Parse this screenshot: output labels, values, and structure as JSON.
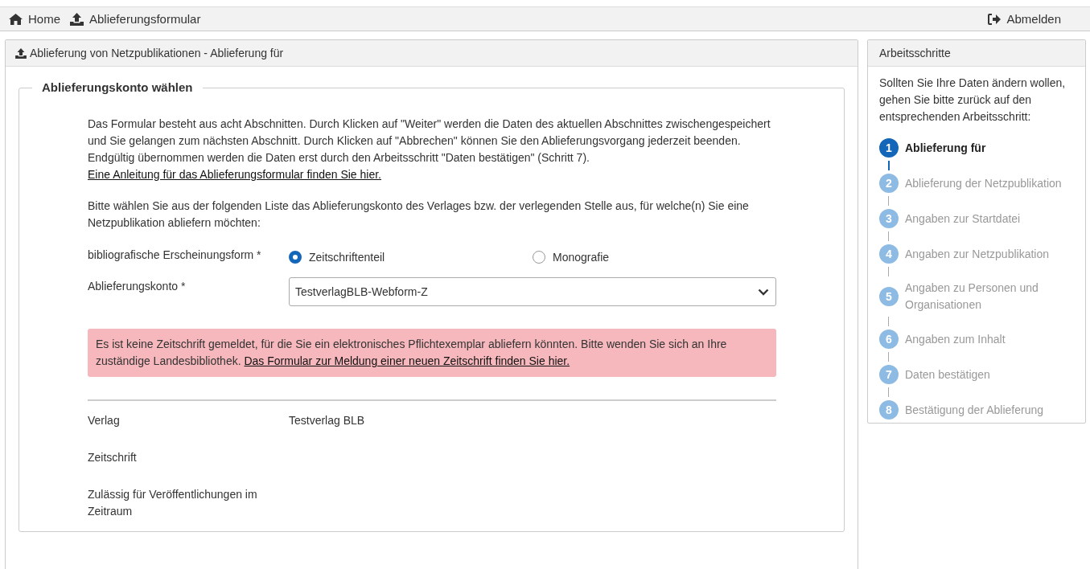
{
  "topbar": {
    "links": [
      {
        "kind": "home",
        "label": "Home"
      },
      {
        "kind": "upload",
        "label": "Ablieferungsformular"
      }
    ],
    "logout": "Abmelden"
  },
  "main": {
    "title": "Ablieferung von Netzpublikationen - Ablieferung für",
    "fieldset_legend": "Ablieferungskonto wählen",
    "intro": {
      "text": "Das Formular besteht aus acht Abschnitten. Durch Klicken auf \"Weiter\" werden die Daten des aktuellen Abschnittes zwischengespeichert und Sie gelangen zum nächsten Abschnitt. Durch Klicken auf \"Abbrechen\" können Sie den Ablieferungsvorgang jederzeit beenden. Endgültig übernommen werden die Daten erst durch den Arbeitsschritt \"Daten bestätigen\" (Schritt 7).",
      "link": "Eine Anleitung für das Ablieferungsformular finden Sie hier."
    },
    "instruction": "Bitte wählen Sie aus der folgenden Liste das Ablieferungskonto des Verlages bzw. der verlegenden Stelle aus, für welche(n) Sie eine Netzpublikation abliefern möchten:",
    "form_label": "bibliografische Erscheinungsform *",
    "radios": [
      {
        "label": "Zeitschriftenteil",
        "selected": true
      },
      {
        "label": "Monografie",
        "selected": false
      }
    ],
    "account_label": "Ablieferungskonto *",
    "account_value": "TestverlagBLB-Webform-Z",
    "alert": {
      "text": "Es ist keine Zeitschrift gemeldet, für die Sie ein elektronisches Pflichtexemplar abliefern könnten. Bitte wenden Sie sich an Ihre zuständige Landesbibliothek.",
      "link": "Das Formular zur Meldung einer neuen Zeitschrift finden Sie hier."
    },
    "details": [
      {
        "label": "Verlag",
        "value": "Testverlag BLB"
      },
      {
        "label": "Zeitschrift"
      },
      {
        "label": "Zulässig für Veröffentlichungen im Zeitraum"
      }
    ]
  },
  "steps_panel": {
    "title": "Arbeitsschritte",
    "hint": "Sollten Sie Ihre Daten ändern wollen, gehen Sie bitte zurück auf den entsprechenden Arbeitsschritt:",
    "steps": [
      {
        "number": "1",
        "label": "Ablieferung für",
        "selected": true
      },
      {
        "number": "2",
        "label": "Ablieferung der Netzpublikation",
        "selected": false
      },
      {
        "number": "3",
        "label": "Angaben zur Startdatei",
        "selected": false
      },
      {
        "number": "4",
        "label": "Angaben zur Netzpublikation",
        "selected": false
      },
      {
        "number": "5",
        "label": "Angaben zu Personen und Organisationen",
        "selected": false
      },
      {
        "number": "6",
        "label": "Angaben zum Inhalt",
        "selected": false
      },
      {
        "number": "7",
        "label": "Daten bestätigen",
        "selected": false
      },
      {
        "number": "8",
        "label": "Bestätigung der Ablieferung",
        "selected": false
      }
    ]
  }
}
